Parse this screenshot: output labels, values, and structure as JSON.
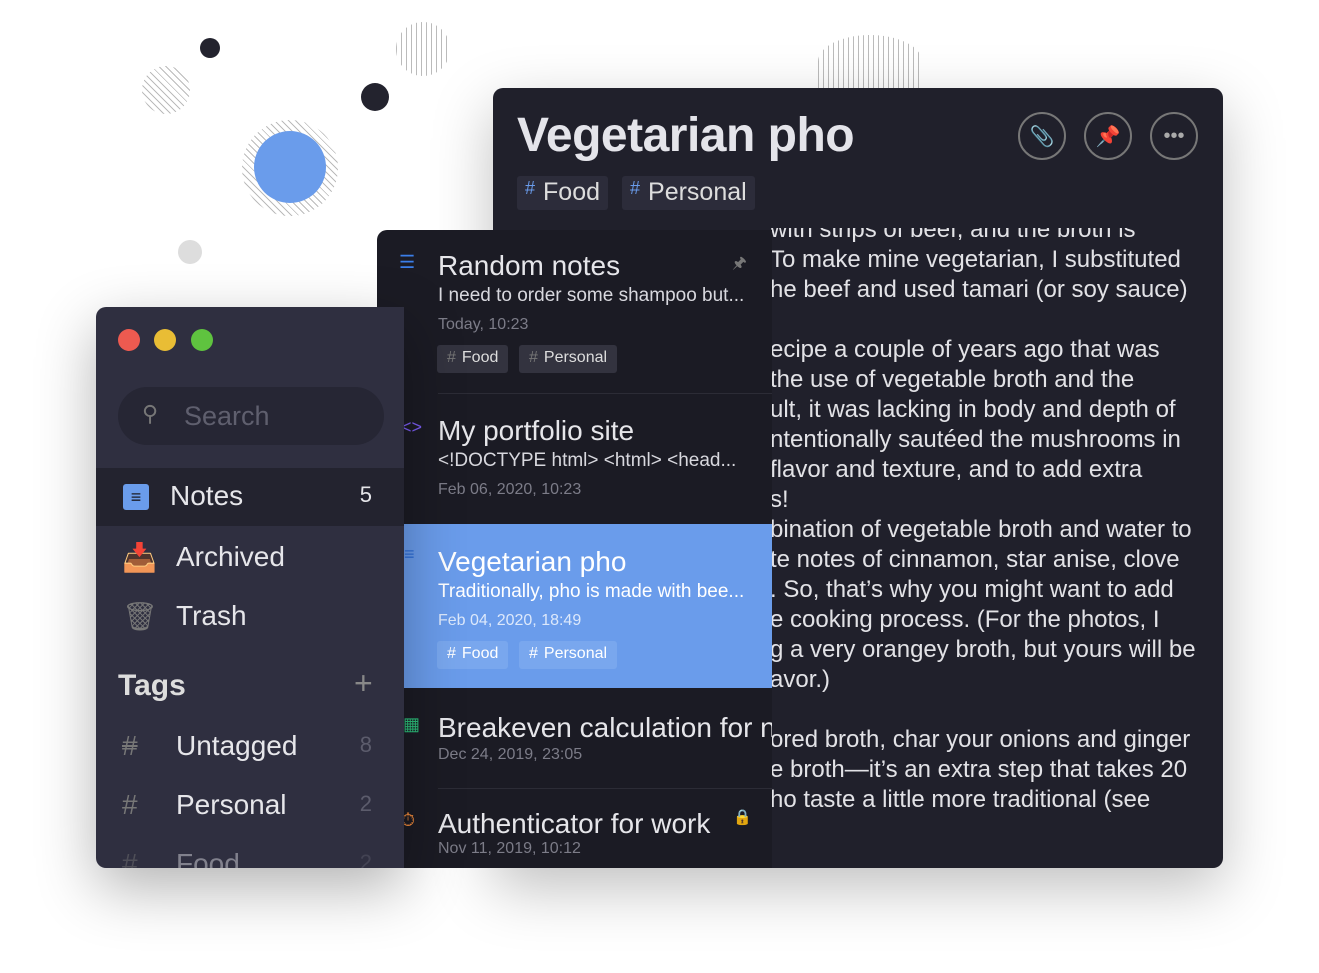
{
  "colors": {
    "accent": "#6a9ceb",
    "sidebar_bg": "#2f2f40",
    "list_bg": "#1b1b24",
    "editor_bg": "#20202b"
  },
  "editor": {
    "title": "Vegetarian pho",
    "tags": [
      "Food",
      "Personal"
    ],
    "buttons": [
      {
        "icon": "paperclip-icon"
      },
      {
        "icon": "pin-icon"
      },
      {
        "icon": "more-icon"
      }
    ],
    "lines": [
      "with strips of beef, and the broth is",
      "To make mine vegetarian, I substituted",
      "he beef and used tamari (or soy sauce)",
      "",
      "ecipe a couple of years ago that was",
      "the use of vegetable broth and the",
      "ult, it was lacking in body and depth of",
      "ntentionally sautéed the mushrooms in",
      " flavor and texture, and to add extra",
      "s!",
      "bination of vegetable broth and water to",
      "te notes of cinnamon, star anise, clove",
      ". So, that’s why you might want to add",
      "e cooking process. (For the photos, I",
      "g a very orangey broth, but yours will be",
      "avor.)",
      "",
      "ored broth, char your onions and ginger",
      "e broth—it’s an extra step that takes 20",
      "ho taste a little more traditional (see"
    ]
  },
  "notes": [
    {
      "title": "Random notes",
      "preview": "I need to order some shampoo but...",
      "date": "Today, 10:23",
      "tags": [
        "Food",
        "Personal"
      ],
      "icon": "plain-text-icon",
      "pinned": true
    },
    {
      "title": "My portfolio site",
      "preview": "<!DOCTYPE html> <html> <head...",
      "date": "Feb 06, 2020, 10:23",
      "tags": [],
      "icon": "code-icon"
    },
    {
      "title": "Vegetarian pho",
      "preview": "Traditionally, pho is made with bee...",
      "date": "Feb 04, 2020, 18:49",
      "tags": [
        "Food",
        "Personal"
      ],
      "icon": "markdown-icon",
      "selected": true
    },
    {
      "title": "Breakeven calculation for n",
      "date": "Dec 24, 2019, 23:05",
      "icon": "spreadsheet-icon"
    },
    {
      "title": "Authenticator for work",
      "date": "Nov 11, 2019, 10:12",
      "icon": "authenticator-icon",
      "locked": true
    }
  ],
  "sidebar": {
    "search_placeholder": "Search",
    "views": [
      {
        "label": "Notes",
        "count": "5"
      },
      {
        "label": "Archived"
      },
      {
        "label": "Trash"
      }
    ],
    "tags_heading": "Tags",
    "tags": [
      {
        "label": "Untagged",
        "count": "8"
      },
      {
        "label": "Personal",
        "count": "2"
      },
      {
        "label": "Food",
        "count": "2"
      }
    ]
  }
}
